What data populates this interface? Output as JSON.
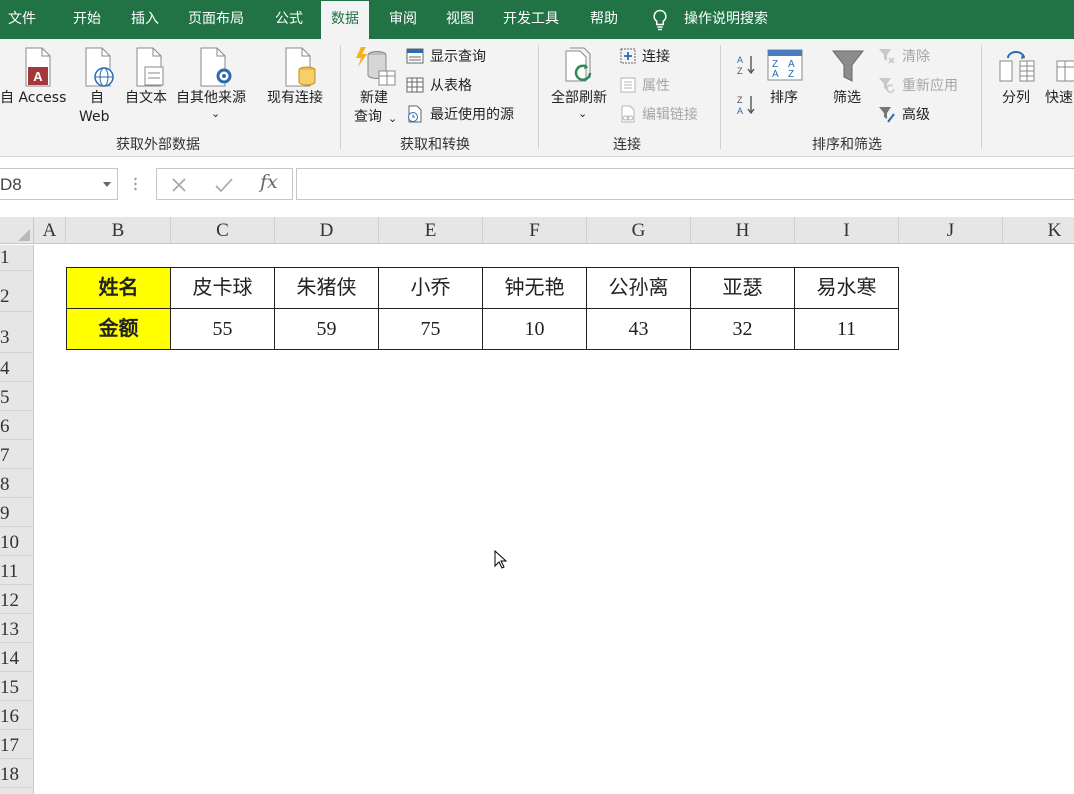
{
  "menu": {
    "tabs": [
      "文件",
      "开始",
      "插入",
      "页面布局",
      "公式",
      "数据",
      "审阅",
      "视图",
      "开发工具",
      "帮助"
    ],
    "active_tab": "数据",
    "tell_me": "操作说明搜索"
  },
  "ribbon": {
    "get_external": {
      "from_access": "自 Access",
      "from_web_1": "自",
      "from_web_2": "Web",
      "from_text": "自文本",
      "from_other": "自其他来源",
      "existing": "现有连接",
      "group_label": "获取外部数据"
    },
    "get_transform": {
      "new_query_1": "新建",
      "new_query_2": "查询",
      "show_queries": "显示查询",
      "from_table": "从表格",
      "recent_sources": "最近使用的源",
      "group_label": "获取和转换"
    },
    "connections": {
      "refresh_all": "全部刷新",
      "connections": "连接",
      "properties": "属性",
      "edit_links": "编辑链接",
      "group_label": "连接"
    },
    "sort_filter": {
      "sort": "排序",
      "filter": "筛选",
      "clear": "清除",
      "reapply": "重新应用",
      "advanced": "高级",
      "group_label": "排序和筛选"
    },
    "data_tools": {
      "text_to_columns": "分列",
      "flash_fill": "快速"
    }
  },
  "formula_bar": {
    "name_box": "D8",
    "formula": ""
  },
  "sheet": {
    "columns": [
      "A",
      "B",
      "C",
      "D",
      "E",
      "F",
      "G",
      "H",
      "I",
      "J",
      "K"
    ],
    "rows": [
      "1",
      "2",
      "3",
      "4",
      "5",
      "6",
      "7",
      "8",
      "9",
      "10",
      "11",
      "12",
      "13",
      "14",
      "15",
      "16",
      "17",
      "18"
    ],
    "table": {
      "row_labels": [
        "姓名",
        "金额"
      ],
      "names": [
        "皮卡球",
        "朱猪侠",
        "小乔",
        "钟无艳",
        "公孙离",
        "亚瑟",
        "易水寒"
      ],
      "amounts": [
        "55",
        "59",
        "75",
        "10",
        "43",
        "32",
        "11"
      ]
    }
  },
  "colors": {
    "excel_green": "#217346",
    "header_fill": "#ffff00",
    "ribbon_bg": "#f3f3f3"
  }
}
